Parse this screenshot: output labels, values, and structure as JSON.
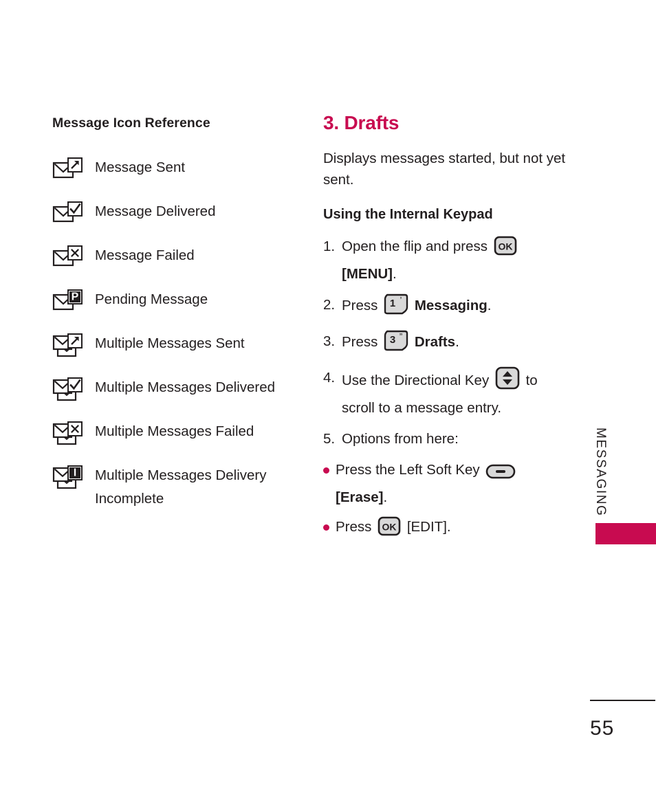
{
  "left_column": {
    "title": "Message Icon Reference",
    "items": [
      {
        "icon": "envelope-sent-icon",
        "label": "Message Sent",
        "variant": "single",
        "badge": "arrow"
      },
      {
        "icon": "envelope-delivered-icon",
        "label": "Message Delivered",
        "variant": "single",
        "badge": "check"
      },
      {
        "icon": "envelope-failed-icon",
        "label": "Message Failed",
        "variant": "single",
        "badge": "x"
      },
      {
        "icon": "envelope-pending-icon",
        "label": "Pending Message",
        "variant": "single",
        "badge": "P"
      },
      {
        "icon": "multiple-envelopes-sent-icon",
        "label": "Multiple Messages Sent",
        "variant": "multiple",
        "badge": "arrow"
      },
      {
        "icon": "multiple-envelopes-delivered-icon",
        "label": "Multiple Messages Delivered",
        "variant": "multiple",
        "badge": "check"
      },
      {
        "icon": "multiple-envelopes-failed-icon",
        "label": "Multiple Messages Failed",
        "variant": "multiple",
        "badge": "x"
      },
      {
        "icon": "multiple-envelopes-incomplete-icon",
        "label": "Multiple Messages Delivery Incomplete",
        "variant": "multiple",
        "badge": "I"
      }
    ]
  },
  "right_column": {
    "heading": "3. Drafts",
    "description": "Displays messages started, but not yet sent.",
    "subheading": "Using the Internal Keypad",
    "steps": [
      {
        "number": "1.",
        "parts": [
          {
            "type": "text",
            "value": "Open the flip and press "
          },
          {
            "type": "key",
            "key": "OK",
            "icon": "ok-key-icon"
          },
          {
            "type": "text",
            "value": " "
          },
          {
            "type": "bold",
            "value": "[MENU]"
          },
          {
            "type": "text",
            "value": "."
          }
        ]
      },
      {
        "number": "2.",
        "parts": [
          {
            "type": "text",
            "value": "Press "
          },
          {
            "type": "key",
            "key": "1",
            "mark": "’",
            "icon": "numeric-key-1-icon"
          },
          {
            "type": "text",
            "value": " "
          },
          {
            "type": "bold",
            "value": "Messaging"
          },
          {
            "type": "text",
            "value": "."
          }
        ]
      },
      {
        "number": "3.",
        "parts": [
          {
            "type": "text",
            "value": "Press "
          },
          {
            "type": "key",
            "key": "3",
            "mark": "”",
            "icon": "numeric-key-3-icon"
          },
          {
            "type": "text",
            "value": " "
          },
          {
            "type": "bold",
            "value": "Drafts"
          },
          {
            "type": "text",
            "value": "."
          }
        ]
      },
      {
        "number": "4.",
        "parts": [
          {
            "type": "text",
            "value": "Use the Directional Key "
          },
          {
            "type": "key",
            "key": "updown",
            "icon": "directional-key-icon"
          },
          {
            "type": "text",
            "value": " to scroll to a message entry."
          }
        ]
      },
      {
        "number": "5.",
        "parts": [
          {
            "type": "text",
            "value": "Options from here:"
          }
        ]
      }
    ],
    "bullets": [
      {
        "parts": [
          {
            "type": "text",
            "value": "Press the Left Soft Key "
          },
          {
            "type": "key",
            "key": "softkey",
            "icon": "left-soft-key-icon"
          },
          {
            "type": "text",
            "value": " "
          },
          {
            "type": "bold",
            "value": "[Erase]"
          },
          {
            "type": "text",
            "value": "."
          }
        ]
      },
      {
        "parts": [
          {
            "type": "text",
            "value": "Press "
          },
          {
            "type": "key",
            "key": "OK",
            "icon": "ok-key-icon"
          },
          {
            "type": "text",
            "value": " "
          },
          {
            "type": "text",
            "value": "[EDIT]."
          }
        ]
      }
    ]
  },
  "side_tab": {
    "label": "MESSAGING"
  },
  "footer": {
    "page_number": "55"
  },
  "colors": {
    "accent": "#c80b50",
    "text": "#231f20",
    "key_fill": "#d9d9d9"
  }
}
